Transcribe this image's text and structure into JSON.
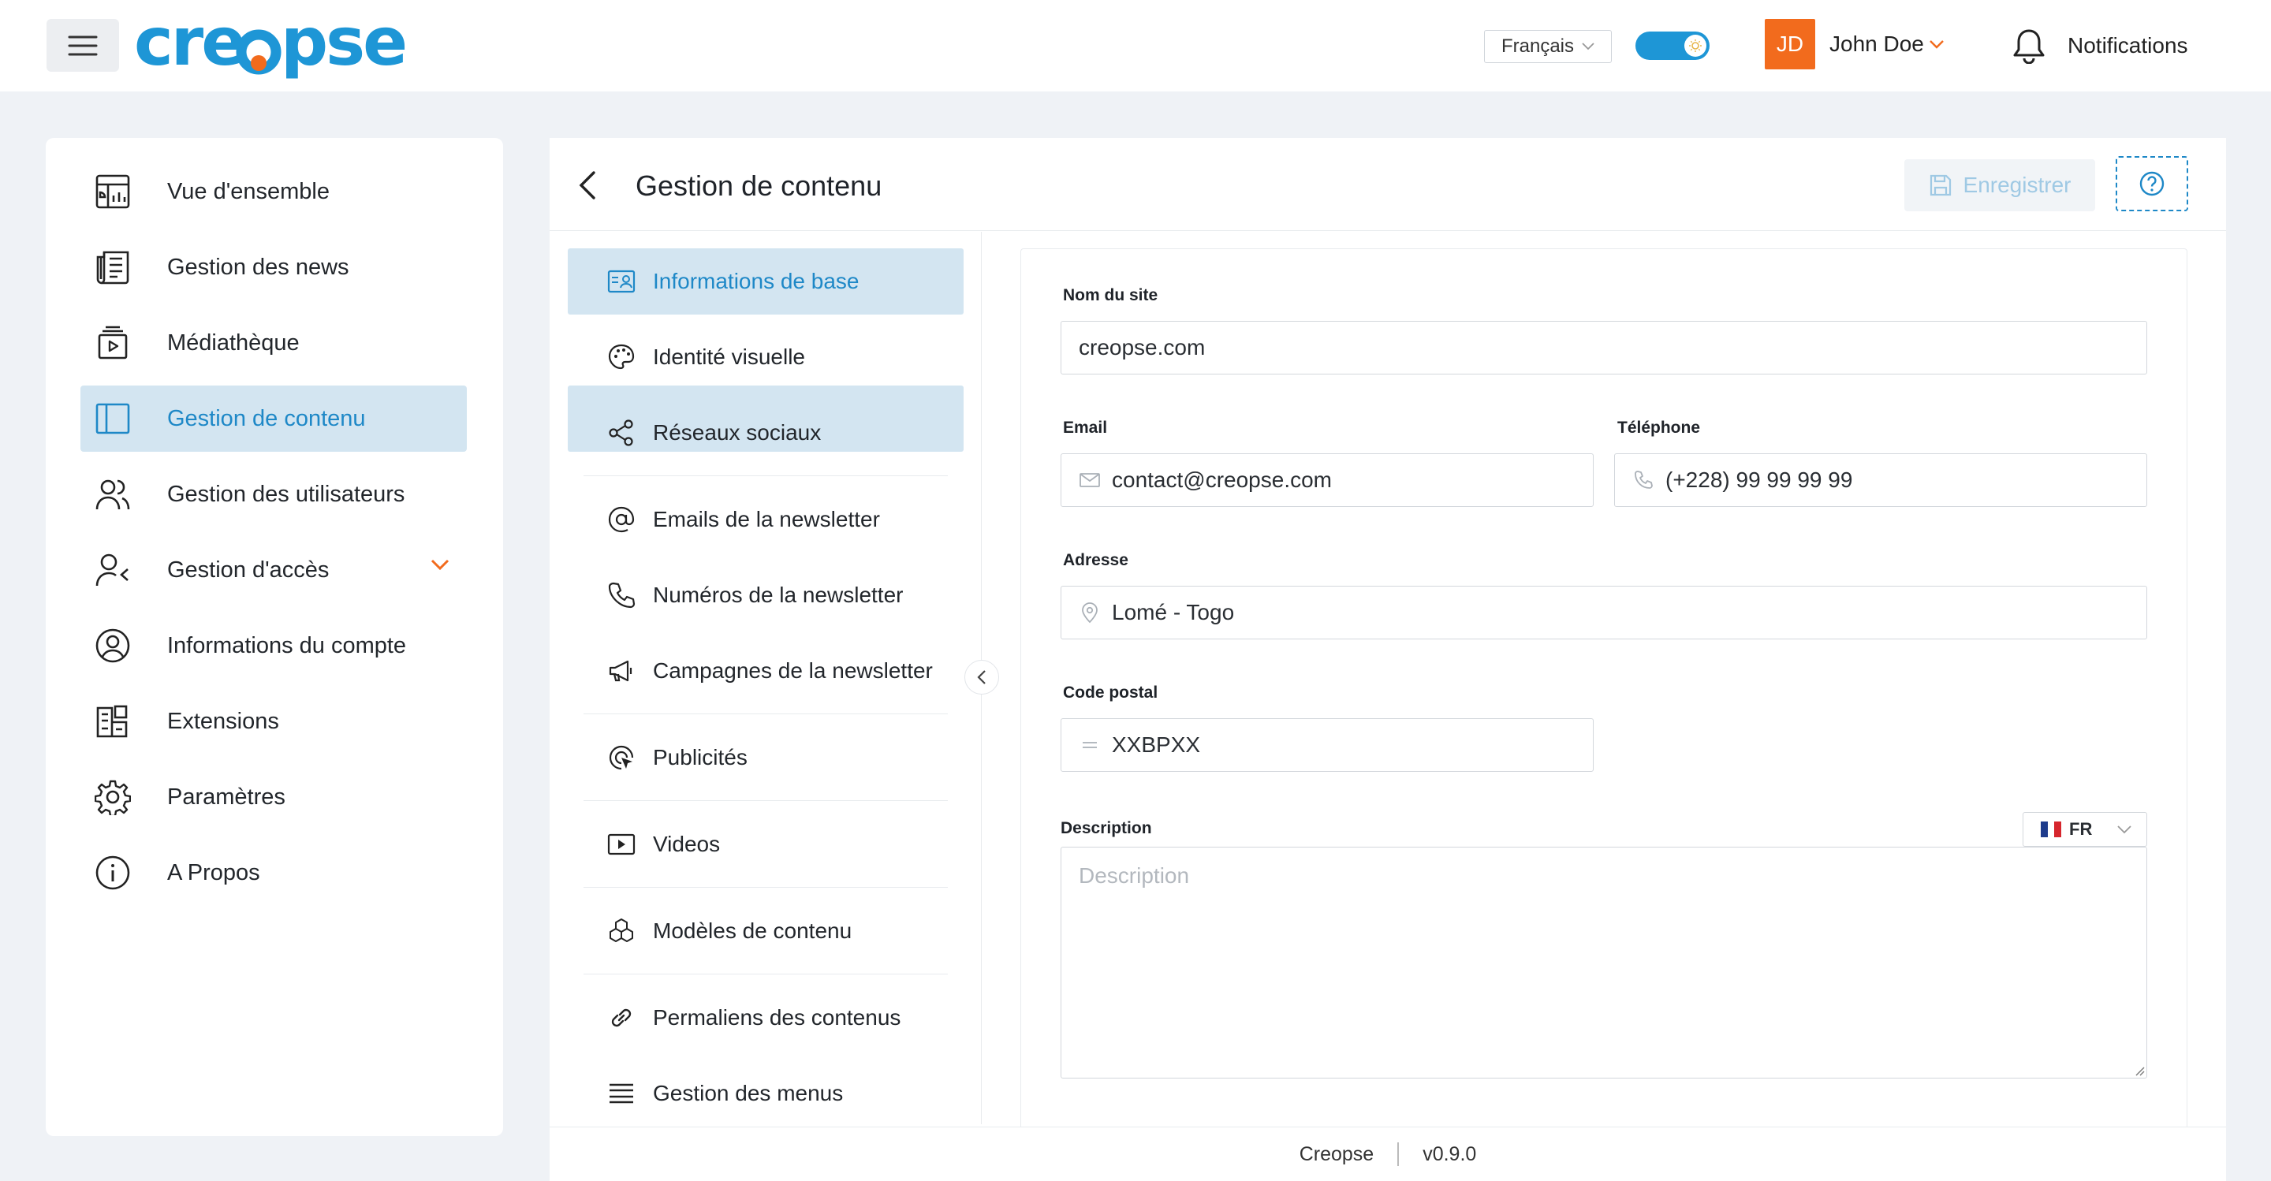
{
  "header": {
    "logo_text": "creopse",
    "language": "Français",
    "user_initials": "JD",
    "user_name": "John Doe",
    "notifications_label": "Notifications",
    "colors": {
      "brand_blue": "#1e96d6",
      "brand_orange": "#f26b1d"
    }
  },
  "sidebar": {
    "items": [
      {
        "label": "Vue d'ensemble",
        "icon": "dashboard-icon"
      },
      {
        "label": "Gestion des news",
        "icon": "newspaper-icon"
      },
      {
        "label": "Médiathèque",
        "icon": "media-library-icon"
      },
      {
        "label": "Gestion de contenu",
        "icon": "layout-icon",
        "active": true
      },
      {
        "label": "Gestion des utilisateurs",
        "icon": "users-icon"
      },
      {
        "label": "Gestion d'accès",
        "icon": "user-access-icon",
        "expandable": true
      },
      {
        "label": "Informations du compte",
        "icon": "account-circle-icon"
      },
      {
        "label": "Extensions",
        "icon": "extensions-icon"
      },
      {
        "label": "Paramètres",
        "icon": "settings-gear-icon"
      },
      {
        "label": "A Propos",
        "icon": "info-icon"
      }
    ]
  },
  "main": {
    "title": "Gestion de contenu",
    "save_label": "Enregistrer"
  },
  "subnav": {
    "items": [
      {
        "label": "Informations de base",
        "icon": "id-card-icon",
        "active": true
      },
      {
        "label": "Identité visuelle",
        "icon": "palette-icon"
      },
      {
        "label": "Réseaux sociaux",
        "icon": "share-icon"
      },
      {
        "label": "Emails de la newsletter",
        "icon": "at-sign-icon"
      },
      {
        "label": "Numéros de la newsletter",
        "icon": "phone-icon"
      },
      {
        "label": "Campagnes de la newsletter",
        "icon": "megaphone-icon"
      },
      {
        "label": "Publicités",
        "icon": "ad-target-icon"
      },
      {
        "label": "Videos",
        "icon": "video-icon"
      },
      {
        "label": "Modèles de contenu",
        "icon": "blocks-icon"
      },
      {
        "label": "Permaliens des contenus",
        "icon": "link-icon"
      },
      {
        "label": "Gestion des menus",
        "icon": "menu-lines-icon"
      }
    ]
  },
  "form": {
    "site_name": {
      "label": "Nom du site",
      "value": "creopse.com"
    },
    "email": {
      "label": "Email",
      "value": "contact@creopse.com"
    },
    "phone": {
      "label": "Téléphone",
      "value": "(+228) 99 99 99 99"
    },
    "address": {
      "label": "Adresse",
      "value": "Lomé - Togo"
    },
    "postal_code": {
      "label": "Code postal",
      "value": "XXBPXX"
    },
    "description": {
      "label": "Description",
      "placeholder": "Description",
      "lang": "FR"
    }
  },
  "footer": {
    "app_name": "Creopse",
    "version": "v0.9.0"
  }
}
